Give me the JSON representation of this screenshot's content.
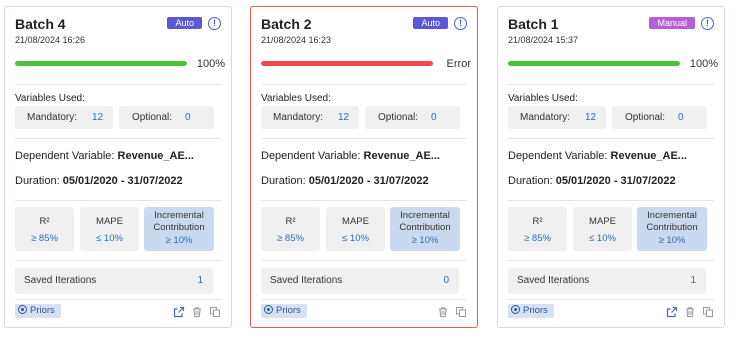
{
  "cards": [
    {
      "title": "Batch 4",
      "date": "21/08/2024 16:26",
      "badge": "Auto",
      "badge_type": "auto",
      "progress": 1.0,
      "progress_label": "100%",
      "progress_color": "#4cc23a",
      "variables_label": "Variables Used:",
      "mandatory_label": "Mandatory:",
      "mandatory_count": "12",
      "optional_label": "Optional:",
      "optional_count": "0",
      "dependent_label": "Dependent Variable:",
      "dependent_value": "Revenue_AE...",
      "duration_label": "Duration:",
      "duration_value": "05/01/2020 - 31/07/2022",
      "metrics": [
        {
          "name": "R²",
          "value": "≥ 85%"
        },
        {
          "name": "MAPE",
          "value": "≤ 10%"
        },
        {
          "name": "Incremental Contribution",
          "value": "≥ 10%"
        }
      ],
      "saved_label": "Saved Iterations",
      "saved_count": "1",
      "priors_label": "Priors",
      "error": false,
      "show_open": true
    },
    {
      "title": "Batch 2",
      "date": "21/08/2024 16:23",
      "badge": "Auto",
      "badge_type": "auto",
      "progress": 1.0,
      "progress_label": "Error",
      "progress_color": "#f0474e",
      "variables_label": "Variables Used:",
      "mandatory_label": "Mandatory:",
      "mandatory_count": "12",
      "optional_label": "Optional:",
      "optional_count": "0",
      "dependent_label": "Dependent Variable:",
      "dependent_value": "Revenue_AE...",
      "duration_label": "Duration:",
      "duration_value": "05/01/2020 - 31/07/2022",
      "metrics": [
        {
          "name": "R²",
          "value": "≥ 85%"
        },
        {
          "name": "MAPE",
          "value": "≤ 10%"
        },
        {
          "name": "Incremental Contribution",
          "value": "≥ 10%"
        }
      ],
      "saved_label": "Saved Iterations",
      "saved_count": "0",
      "priors_label": "Priors",
      "error": true,
      "show_open": false
    },
    {
      "title": "Batch 1",
      "date": "21/08/2024 15:37",
      "badge": "Manual",
      "badge_type": "manual",
      "progress": 1.0,
      "progress_label": "100%",
      "progress_color": "#4cc23a",
      "variables_label": "Variables Used:",
      "mandatory_label": "Mandatory:",
      "mandatory_count": "12",
      "optional_label": "Optional:",
      "optional_count": "0",
      "dependent_label": "Dependent Variable:",
      "dependent_value": "Revenue_AE...",
      "duration_label": "Duration:",
      "duration_value": "05/01/2020 - 31/07/2022",
      "metrics": [
        {
          "name": "R²",
          "value": "≥ 85%"
        },
        {
          "name": "MAPE",
          "value": "≤ 10%"
        },
        {
          "name": "Incremental Contribution",
          "value": "≥ 10%"
        }
      ],
      "saved_label": "Saved Iterations",
      "saved_count": "1",
      "priors_label": "Priors",
      "error": false,
      "show_open": true
    }
  ],
  "icons": {
    "info": "info-icon",
    "priors": "settings-check-icon",
    "open": "open-external-icon",
    "delete": "trash-icon",
    "copy": "copy-icon"
  },
  "colors": {
    "auto_badge": "#5b58d6",
    "manual_badge": "#b65fd9",
    "error_border": "#e05a5a",
    "link_blue": "#2b6cb8",
    "highlight_metric": "#c9daf0"
  }
}
